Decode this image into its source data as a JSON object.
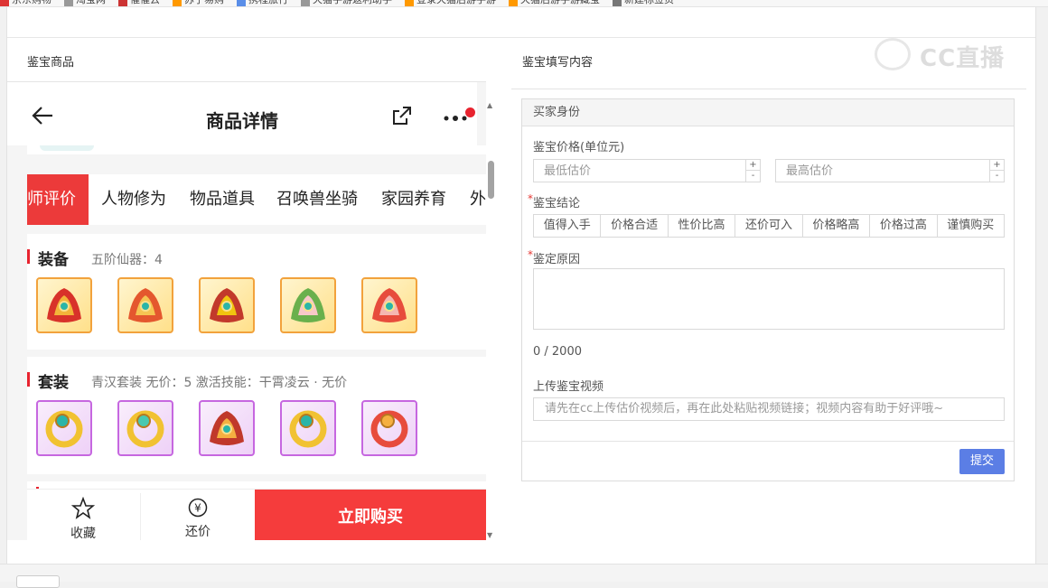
{
  "bookmarks": [
    "京东购物",
    "淘宝网",
    "催催云",
    "苏宁易购",
    "携程旅行",
    "天猫手游返利助手",
    "登录天猫后游手游",
    "天猫后游手游藏宝",
    "新建标签页"
  ],
  "left_section": {
    "title": "鉴宝商品"
  },
  "right_section": {
    "title": "鉴宝填写内容"
  },
  "watermark": {
    "text": "CC直播"
  },
  "phone": {
    "title": "商品详情",
    "tabs": [
      "师评价",
      "人物修为",
      "物品道具",
      "召唤兽坐骑",
      "家园养育",
      "外"
    ],
    "active_tab": 0,
    "equipment": {
      "heading": "装备",
      "sub": "五阶仙器：4",
      "items": [
        "equipment-item-1",
        "equipment-item-2",
        "equipment-item-3",
        "equipment-item-4",
        "equipment-item-5"
      ]
    },
    "suit": {
      "heading": "套装",
      "sub": "青汉套装 无价：5 激活技能：干霄凌云 · 无价",
      "items": [
        "suit-item-1",
        "suit-item-2",
        "suit-item-3",
        "suit-item-4",
        "suit-item-5"
      ]
    },
    "bottom": {
      "favorite_label": "收藏",
      "bargain_label": "还价",
      "buy_label": "立即购买"
    }
  },
  "form": {
    "header": "买家身份",
    "price_label": "鉴宝价格(单位元)",
    "min_placeholder": "最低估价",
    "max_placeholder": "最高估价",
    "conclusion_label": "鉴宝结论",
    "conclusion_options": [
      "值得入手",
      "价格合适",
      "性价比高",
      "还价可入",
      "价格略高",
      "价格过高",
      "谨慎购买"
    ],
    "reason_label": "鉴定原因",
    "counter": "0 / 2000",
    "video_label": "上传鉴宝视频",
    "video_placeholder": "请先在cc上传估价视频后，再在此处粘贴视频链接；视频内容有助于好评哦~",
    "submit_label": "提交"
  },
  "colors": {
    "accent_red": "#f53c3c",
    "submit_blue": "#5b7ee5",
    "gold_border": "#f2a23c",
    "purple_border": "#c667e0"
  }
}
